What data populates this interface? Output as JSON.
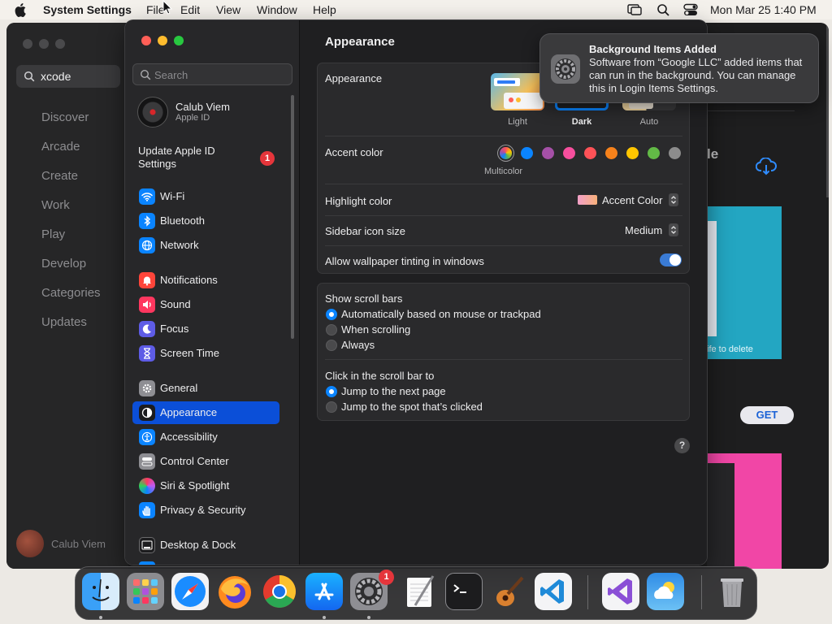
{
  "menubar": {
    "app_name": "System Settings",
    "menus": [
      "File",
      "Edit",
      "View",
      "Window",
      "Help"
    ],
    "clock": "Mon Mar 25  1:40 PM",
    "right_icons": [
      "screen-mirroring-icon",
      "spotlight-search-icon",
      "control-center-icon"
    ]
  },
  "appstore": {
    "search_value": "xcode",
    "nav": [
      "Discover",
      "Arcade",
      "Create",
      "Work",
      "Play",
      "Develop",
      "Categories",
      "Updates"
    ],
    "user_name": "Calub Viem",
    "partial_heading": "le",
    "card_caption": "ife to delete",
    "get_label": "GET"
  },
  "settings": {
    "search_placeholder": "Search",
    "profile": {
      "name": "Calub Viem",
      "subtitle": "Apple ID"
    },
    "update": {
      "label": "Update Apple ID Settings",
      "badge": "1"
    },
    "sidebar": [
      {
        "label": "Wi-Fi",
        "icon": "wifi-icon",
        "color": "#0a84ff"
      },
      {
        "label": "Bluetooth",
        "icon": "bluetooth-icon",
        "color": "#0a84ff"
      },
      {
        "label": "Network",
        "icon": "globe-icon",
        "color": "#0a84ff"
      },
      {
        "label": "Notifications",
        "icon": "bell-icon",
        "color": "#ff453a"
      },
      {
        "label": "Sound",
        "icon": "speaker-icon",
        "color": "#ff375f"
      },
      {
        "label": "Focus",
        "icon": "moon-icon",
        "color": "#5e5ce6"
      },
      {
        "label": "Screen Time",
        "icon": "hourglass-icon",
        "color": "#5e5ce6"
      },
      {
        "label": "General",
        "icon": "gear-icon",
        "color": "#8e8e93"
      },
      {
        "label": "Appearance",
        "icon": "appearance-icon",
        "color": "#1c1c1e"
      },
      {
        "label": "Accessibility",
        "icon": "accessibility-icon",
        "color": "#0a84ff"
      },
      {
        "label": "Control Center",
        "icon": "control-center-icon",
        "color": "#8e8e93"
      },
      {
        "label": "Siri & Spotlight",
        "icon": "siri-icon",
        "color": "#bf5af2"
      },
      {
        "label": "Privacy & Security",
        "icon": "hand-icon",
        "color": "#0a84ff"
      },
      {
        "label": "Desktop & Dock",
        "icon": "dock-icon",
        "color": "#1c1c1e"
      }
    ],
    "selected": "Appearance",
    "page_title": "Appearance",
    "appearance": {
      "label": "Appearance",
      "options": [
        "Light",
        "Dark",
        "Auto"
      ],
      "selected": "Dark"
    },
    "accent": {
      "label": "Accent color",
      "colors": [
        "multicolor",
        "#0a84ff",
        "#a550a7",
        "#f74f9e",
        "#ff5257",
        "#f7821b",
        "#ffc600",
        "#62ba46",
        "#8c8c8c"
      ],
      "selected": "multicolor",
      "selected_label": "Multicolor"
    },
    "highlight": {
      "label": "Highlight color",
      "value": "Accent Color"
    },
    "sidebar_icon_size": {
      "label": "Sidebar icon size",
      "value": "Medium"
    },
    "wallpaper_tinting": {
      "label": "Allow wallpaper tinting in windows",
      "enabled": true
    },
    "scroll_bars": {
      "label": "Show scroll bars",
      "options": [
        "Automatically based on mouse or trackpad",
        "When scrolling",
        "Always"
      ],
      "selected": "Automatically based on mouse or trackpad"
    },
    "click_scroll": {
      "label": "Click in the scroll bar to",
      "options": [
        "Jump to the next page",
        "Jump to the spot that’s clicked"
      ],
      "selected": "Jump to the next page"
    },
    "help_label": "?"
  },
  "notification": {
    "title": "Background Items Added",
    "body": "Software from “Google LLC” added items that can run in the background. You can manage this in Login Items Settings.",
    "icon": "gear-icon"
  },
  "dock": {
    "apps": [
      "finder-icon",
      "launchpad-icon",
      "safari-icon",
      "firefox-icon",
      "chrome-icon",
      "app-store-icon",
      "system-settings-icon",
      "textedit-icon",
      "terminal-icon",
      "garageband-icon",
      "vscode-icon",
      "visual-studio-icon",
      "weather-icon",
      "trash-icon"
    ],
    "settings_badge": "1"
  }
}
